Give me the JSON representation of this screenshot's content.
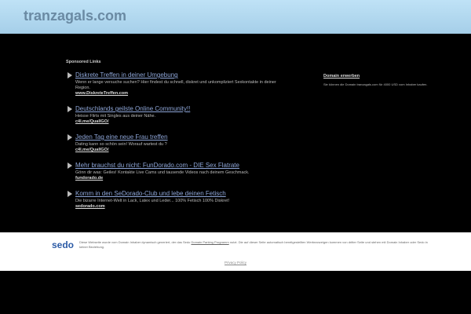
{
  "header": {
    "domain": "tranzagals.com"
  },
  "sponsored": {
    "label": "Sponsored Links",
    "ads": [
      {
        "title": "Diskrete Treffen in deiner Umgebung",
        "desc": "Wenn er lange versuche suchen? Hier findest du schnell, diskret und unkompliziert Sexkontakte in deiner Region.",
        "url": "www.DiskreteTreffen.com"
      },
      {
        "title": "Deutschlands geilste Online Community!!",
        "desc": "Heisse Flirts mit Singles aus deiner Nähe.",
        "url": "c4l.me/QualIGO/"
      },
      {
        "title": "Jeden Tag eine neue Frau treffen",
        "desc": "Dating kann so schön sein! Worauf wartest du ?",
        "url": "c4l.me/QualIGO/"
      },
      {
        "title": "Mehr brauchst du nicht: FunDorado.com - DIE Sex Flatrate",
        "desc": "Gönn dir was: Geiles! Kontakte Live Cams und tausende Videos nach deinem Geschmack.",
        "url": "fundorado.de"
      },
      {
        "title": "Komm in den SeDorado-Club und lebe deinen Fetisch",
        "desc": "Die bizarre Internet-Welt in Lack, Latex und Leder... 100% Fetisch 100% Diskret!",
        "url": "sedorado.com"
      }
    ]
  },
  "side": {
    "title": "Domain erwerben",
    "text": "Sie können die Domain tranzagals.com für 4000 USD vom Inhaber kaufen."
  },
  "footer": {
    "logo": "sedo",
    "text_before": "Diese Webseite wurde vom Domain Inhaber dynamisch generiert, der das Sedo ",
    "link": "Domain Parking Programm",
    "text_after": " nutzt. Die auf dieser Seite automatisch bereitgestellten Werbeanzeigen kommen von dritter Seite und stehen mit Domain Inhaber oder Sedo in keiner Beziehung.",
    "privacy": "Privacy Policy"
  }
}
